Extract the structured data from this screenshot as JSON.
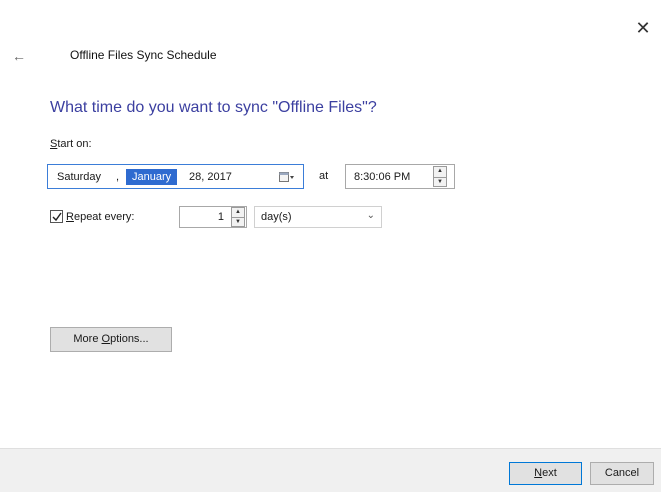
{
  "window": {
    "close_glyph": "✕",
    "back_glyph": "←",
    "title": "Offline Files Sync Schedule"
  },
  "heading": "What time do you want to sync \"Offline Files\"?",
  "start": {
    "label_accel": "S",
    "label_rest": "tart on:",
    "day": "Saturday",
    "comma": ",",
    "month": "January",
    "rest": "28, 2017",
    "at": "at",
    "time": "8:30:06 PM"
  },
  "repeat": {
    "checked": true,
    "label_accel": "R",
    "label_rest": "epeat every:",
    "interval": "1",
    "unit": "day(s)"
  },
  "more_options": {
    "pre": "More ",
    "accel": "O",
    "post": "ptions..."
  },
  "footer": {
    "next_accel": "N",
    "next_rest": "ext",
    "cancel": "Cancel"
  },
  "colors": {
    "accent": "#3b3fa0",
    "selection": "#2e6bd0",
    "focus_border": "#0078d7"
  }
}
